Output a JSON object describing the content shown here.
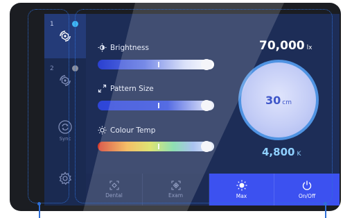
{
  "sidebar": {
    "items": [
      {
        "number": "1",
        "icon": "pattern-hex-icon",
        "active": true,
        "dot_color": "#3fb6f2"
      },
      {
        "number": "2",
        "icon": "pattern-hex-icon",
        "active": false,
        "dot_color": "#8a8f9e"
      },
      {
        "icon": "sync-icon",
        "label": "Sync"
      },
      {
        "icon": "gear-icon"
      }
    ]
  },
  "controls": {
    "brightness": {
      "label": "Brightness",
      "icon": "brightness-icon",
      "level": 0.98
    },
    "pattern_size": {
      "label": "Pattern Size",
      "icon": "expand-arrows-icon",
      "level": 0.98
    },
    "colour_temp": {
      "label": "Colour Temp",
      "icon": "sun-icon",
      "level": 0.98
    }
  },
  "readouts": {
    "lux_value": "70,000",
    "lux_unit": "lx",
    "distance_value": "30",
    "distance_unit": "cm",
    "kelvin_value": "4,800",
    "kelvin_unit": "K"
  },
  "bottom_buttons": [
    {
      "label": "Dental",
      "icon": "dental-mode-icon",
      "active": false
    },
    {
      "label": "Exam",
      "icon": "exam-mode-icon",
      "active": false
    },
    {
      "label": "Max",
      "icon": "max-sun-icon",
      "active": true
    },
    {
      "label": "On/Off",
      "icon": "power-icon",
      "active": true
    }
  ],
  "colors": {
    "screen_bg": "#1d2d57",
    "accent_blue": "#3c51f0",
    "dial_ring": "#4f93e2",
    "annotation": "#2f6fd6"
  }
}
